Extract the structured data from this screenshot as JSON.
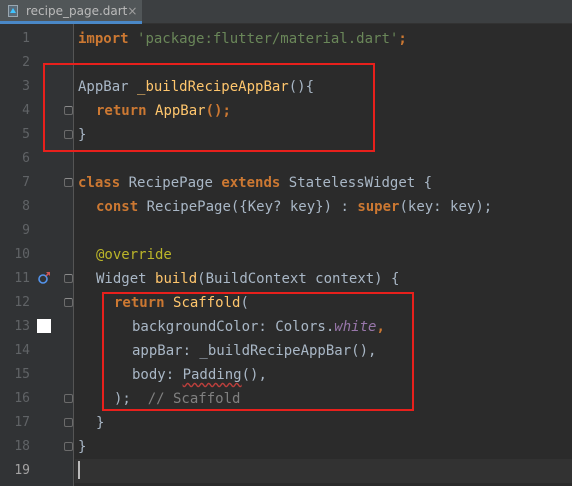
{
  "tab": {
    "filename": "recipe_page.dart",
    "close": "×"
  },
  "gutter": {
    "line_numbers": [
      "1",
      "2",
      "3",
      "4",
      "5",
      "6",
      "7",
      "8",
      "9",
      "10",
      "11",
      "12",
      "13",
      "14",
      "15",
      "16",
      "17",
      "18",
      "19"
    ]
  },
  "code": {
    "l1": {
      "kw": "import",
      "str": "'package:flutter/material.dart'",
      "rest": ";"
    },
    "l3": {
      "type": "AppBar",
      "fn": "_buildRecipeAppBar",
      "rest": "(){"
    },
    "l4": {
      "kw": "return",
      "fn": "AppBar",
      "rest": "();"
    },
    "l5": {
      "text": "}"
    },
    "l7": {
      "kw1": "class",
      "name": "RecipePage",
      "kw2": "extends",
      "rest": "StatelessWidget {"
    },
    "l8": {
      "kw": "const",
      "mid": "RecipePage({Key? key}) : ",
      "kw2": "super",
      "rest": "(key: key);"
    },
    "l10": {
      "ann": "@override"
    },
    "l11": {
      "pre": "Widget ",
      "fn": "build",
      "rest": "(BuildContext context) {"
    },
    "l12": {
      "kw": "return",
      "fn": "Scaffold",
      "rest": "("
    },
    "l13": {
      "pre": "backgroundColor: Colors.",
      "itl": "white",
      "rest": ","
    },
    "l14": {
      "text": "appBar: _buildRecipeAppBar(),"
    },
    "l15": {
      "pre": "body: ",
      "squig": "Padding",
      "rest": "(),"
    },
    "l16": {
      "pre": ");  ",
      "cmt": "// Scaffold"
    },
    "l17": {
      "text": "}"
    },
    "l18": {
      "text": "}"
    }
  },
  "colors": {
    "background": "#2b2b2b",
    "gutter": "#313335",
    "keyword": "#cc7832",
    "string": "#6a8759",
    "function": "#ffc66d",
    "annotation": "#bbb529",
    "highlight_box": "#e8201c"
  },
  "icons": {
    "file": "dart-file-icon",
    "override": "override-marker-icon",
    "color_swatch": "white-color-swatch"
  }
}
